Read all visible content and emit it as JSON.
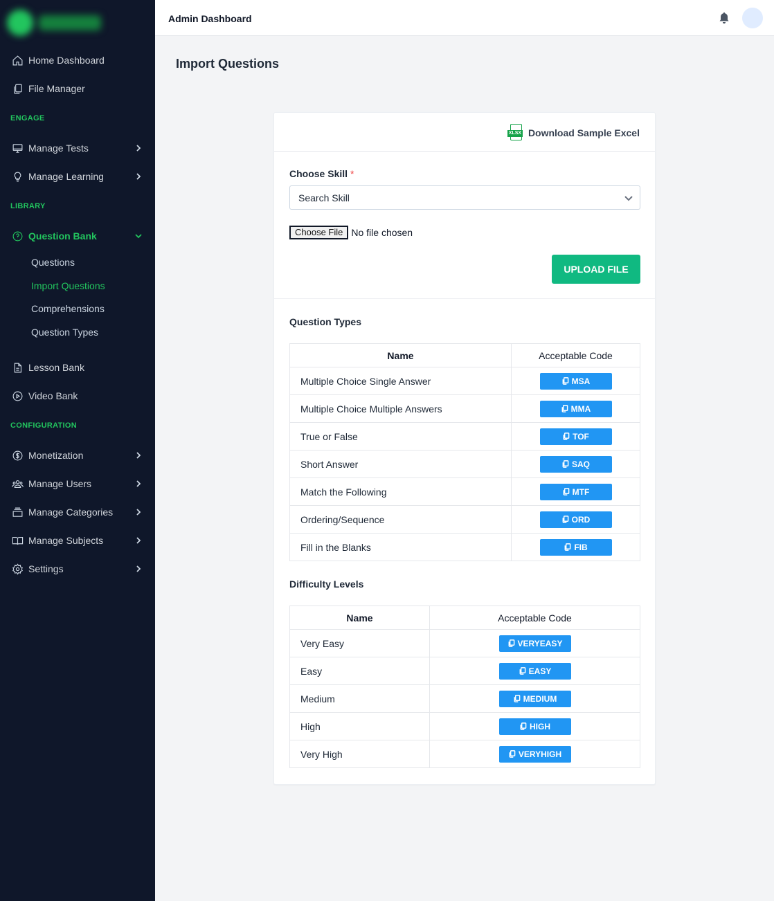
{
  "header": {
    "title": "Admin Dashboard"
  },
  "sidebar": {
    "items": [
      {
        "label": "Home Dashboard",
        "icon": "home-icon"
      },
      {
        "label": "File Manager",
        "icon": "file-manager-icon"
      }
    ],
    "sections": [
      {
        "label": "ENGAGE",
        "items": [
          {
            "label": "Manage Tests"
          },
          {
            "label": "Manage Learning"
          }
        ]
      },
      {
        "label": "LIBRARY",
        "items": [
          {
            "label": "Question Bank",
            "sub": [
              "Questions",
              "Import Questions",
              "Comprehensions",
              "Question Types"
            ]
          },
          {
            "label": "Lesson Bank"
          },
          {
            "label": "Video Bank"
          }
        ]
      },
      {
        "label": "CONFIGURATION",
        "items": [
          {
            "label": "Monetization"
          },
          {
            "label": "Manage Users"
          },
          {
            "label": "Manage Categories"
          },
          {
            "label": "Manage Subjects"
          },
          {
            "label": "Settings"
          }
        ]
      }
    ]
  },
  "page": {
    "title": "Import Questions"
  },
  "form": {
    "download_label": "Download Sample Excel",
    "xlsx_tag": "XLSX",
    "skill_label": "Choose Skill",
    "required_mark": "*",
    "skill_placeholder": "Search Skill",
    "file_button": "Choose File",
    "file_status": "No file chosen",
    "upload_label": "UPLOAD FILE"
  },
  "question_types": {
    "title": "Question Types",
    "headers": [
      "Name",
      "Acceptable Code"
    ],
    "rows": [
      {
        "name": "Multiple Choice Single Answer",
        "code": "MSA"
      },
      {
        "name": "Multiple Choice Multiple Answers",
        "code": "MMA"
      },
      {
        "name": "True or False",
        "code": "TOF"
      },
      {
        "name": "Short Answer",
        "code": "SAQ"
      },
      {
        "name": "Match the Following",
        "code": "MTF"
      },
      {
        "name": "Ordering/Sequence",
        "code": "ORD"
      },
      {
        "name": "Fill in the Blanks",
        "code": "FIB"
      }
    ]
  },
  "difficulty_levels": {
    "title": "Difficulty Levels",
    "headers": [
      "Name",
      "Acceptable Code"
    ],
    "rows": [
      {
        "name": "Very Easy",
        "code": "VERYEASY"
      },
      {
        "name": "Easy",
        "code": "EASY"
      },
      {
        "name": "Medium",
        "code": "MEDIUM"
      },
      {
        "name": "High",
        "code": "HIGH"
      },
      {
        "name": "Very High",
        "code": "VERYHIGH"
      }
    ]
  },
  "colors": {
    "sidebar_bg": "#0f172a",
    "accent_green": "#22c55e",
    "upload_green": "#10b981",
    "code_blue": "#2196f3"
  }
}
